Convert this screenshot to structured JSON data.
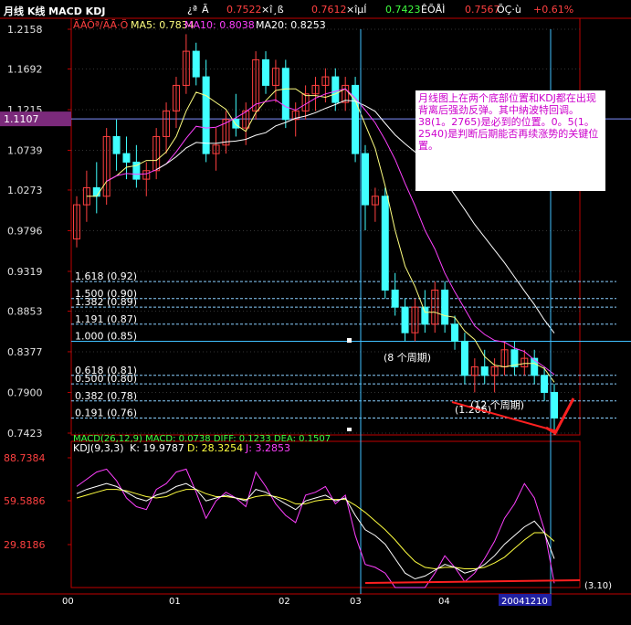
{
  "top_bar": {
    "title": "月线 K线 MACD KDJ",
    "fields": [
      {
        "label": "¿ª",
        "value": "Ã",
        "color": "#ffffff"
      },
      {
        "label": "",
        "value": "0.7522",
        "color": "#ff4040"
      },
      {
        "label": "×î¸ß",
        "value": "",
        "color": "#ffffff"
      },
      {
        "label": "",
        "value": "0.7612",
        "color": "#ff4040"
      },
      {
        "label": "×îµÍ",
        "value": "",
        "color": "#ffffff"
      },
      {
        "label": "",
        "value": "0.7423",
        "color": "#40ff40"
      },
      {
        "label": "ÊÕÅÌ",
        "value": "",
        "color": "#ffffff"
      },
      {
        "label": "",
        "value": "0.7567",
        "color": "#ff4040"
      },
      {
        "label": "ÕÇ·ù",
        "value": "",
        "color": "#ffffff"
      },
      {
        "label": "",
        "value": "+0.61%",
        "color": "#ff4040"
      }
    ]
  },
  "ma_legend": {
    "prefix": "ÃÀÔª/ÃÃ·Ö",
    "ma5": "MA5: 0.7834",
    "ma10": "MA10: 0.8038",
    "ma20": "MA20: 0.8253"
  },
  "price_axis_labels": [
    "1.2158",
    "1.1692",
    "1.1215",
    "1.0739",
    "1.0273",
    "0.9796",
    "0.9319",
    "0.8853",
    "0.8377",
    "0.7900",
    "0.7423"
  ],
  "current_price_label": "1.1107",
  "fib_levels": [
    {
      "label": "1.618 (0.92)",
      "value": 0.92
    },
    {
      "label": "1.500 (0.90)",
      "value": 0.9
    },
    {
      "label": "1.382 (0.89)",
      "value": 0.89
    },
    {
      "label": "1.191 (0.87)",
      "value": 0.87
    },
    {
      "label": "1.000 (0.85)",
      "value": 0.85
    },
    {
      "label": "0.618 (0.81)",
      "value": 0.81
    },
    {
      "label": "0.500 (0.80)",
      "value": 0.8
    },
    {
      "label": "0.382 (0.78)",
      "value": 0.78
    },
    {
      "label": "0.191 (0.76)",
      "value": 0.76
    }
  ],
  "annotations": {
    "box_text": "月线图上在两个底部位置和KDJ都在出现背离后强劲反弹。其中納波特回调。38(1。2765)是必到的位置。0。5(1。2540)是判断后期能否再续涨势的关键位置。",
    "cycle_label_1": "(8 个周期)",
    "cycle_label_2": "(12 个周期)",
    "cycle_label_3": "(1.206)"
  },
  "macd_line": "MACD(26,12,9)  MACD: 0.0738  DIFF: 0.1233  DEA: 0.1507",
  "kdj": {
    "legend_prefix": "KDJ(9,3,3)",
    "k_label": "K: 19.9787",
    "d_label": "D: 28.3254",
    "j_label": "J: 3.2853",
    "axis_labels": [
      "88.7384",
      "59.5886",
      "29.8186"
    ],
    "right_note": "(3.10)"
  },
  "x_axis": {
    "labels": [
      "00",
      "01",
      "02",
      "03",
      "04"
    ],
    "date_box": "20041210"
  },
  "colors": {
    "up": "#ff4040",
    "down": "#40ffff",
    "ma5": "#ffff80",
    "ma10": "#ff40ff",
    "ma20": "#ffffff",
    "k": "#ffffff",
    "d": "#ffff40",
    "j": "#ff40ff"
  },
  "chart_data": {
    "type": "candlestick",
    "title": "月线 K线 MACD KDJ",
    "ylim": [
      0.7423,
      1.2158
    ],
    "ohlc": [
      [
        0.97,
        1.02,
        0.96,
        1.01
      ],
      [
        1.01,
        1.05,
        0.99,
        1.03
      ],
      [
        1.03,
        1.06,
        1.0,
        1.02
      ],
      [
        1.02,
        1.1,
        1.01,
        1.09
      ],
      [
        1.09,
        1.11,
        1.05,
        1.07
      ],
      [
        1.07,
        1.09,
        1.04,
        1.06
      ],
      [
        1.06,
        1.08,
        1.03,
        1.04
      ],
      [
        1.04,
        1.06,
        1.02,
        1.05
      ],
      [
        1.05,
        1.1,
        1.04,
        1.09
      ],
      [
        1.09,
        1.13,
        1.07,
        1.12
      ],
      [
        1.12,
        1.16,
        1.1,
        1.15
      ],
      [
        1.15,
        1.21,
        1.14,
        1.19
      ],
      [
        1.19,
        1.2,
        1.15,
        1.16
      ],
      [
        1.16,
        1.18,
        1.06,
        1.07
      ],
      [
        1.07,
        1.1,
        1.05,
        1.08
      ],
      [
        1.08,
        1.12,
        1.07,
        1.11
      ],
      [
        1.11,
        1.14,
        1.09,
        1.1
      ],
      [
        1.1,
        1.13,
        1.08,
        1.12
      ],
      [
        1.12,
        1.19,
        1.11,
        1.18
      ],
      [
        1.18,
        1.19,
        1.14,
        1.15
      ],
      [
        1.15,
        1.18,
        1.13,
        1.17
      ],
      [
        1.17,
        1.18,
        1.1,
        1.11
      ],
      [
        1.11,
        1.13,
        1.09,
        1.12
      ],
      [
        1.12,
        1.15,
        1.11,
        1.14
      ],
      [
        1.14,
        1.16,
        1.12,
        1.15
      ],
      [
        1.15,
        1.17,
        1.13,
        1.16
      ],
      [
        1.16,
        1.17,
        1.12,
        1.13
      ],
      [
        1.13,
        1.16,
        1.12,
        1.15
      ],
      [
        1.15,
        1.16,
        1.06,
        1.07
      ],
      [
        1.07,
        1.08,
        0.98,
        1.01
      ],
      [
        1.01,
        1.03,
        0.99,
        1.02
      ],
      [
        1.02,
        1.03,
        0.9,
        0.91
      ],
      [
        0.91,
        0.93,
        0.88,
        0.89
      ],
      [
        0.89,
        0.9,
        0.85,
        0.86
      ],
      [
        0.86,
        0.9,
        0.85,
        0.89
      ],
      [
        0.89,
        0.91,
        0.86,
        0.87
      ],
      [
        0.87,
        0.92,
        0.86,
        0.91
      ],
      [
        0.91,
        0.92,
        0.86,
        0.87
      ],
      [
        0.87,
        0.88,
        0.84,
        0.85
      ],
      [
        0.85,
        0.86,
        0.8,
        0.81
      ],
      [
        0.81,
        0.83,
        0.79,
        0.82
      ],
      [
        0.82,
        0.84,
        0.8,
        0.81
      ],
      [
        0.81,
        0.83,
        0.79,
        0.82
      ],
      [
        0.82,
        0.85,
        0.81,
        0.84
      ],
      [
        0.84,
        0.85,
        0.81,
        0.82
      ],
      [
        0.82,
        0.84,
        0.81,
        0.83
      ],
      [
        0.83,
        0.84,
        0.8,
        0.81
      ],
      [
        0.81,
        0.82,
        0.78,
        0.79
      ],
      [
        0.79,
        0.8,
        0.74,
        0.76
      ]
    ],
    "kdj_ylim": [
      0,
      100
    ],
    "kdj_k": [
      65,
      68,
      70,
      72,
      70,
      66,
      62,
      60,
      64,
      66,
      70,
      72,
      68,
      60,
      62,
      64,
      62,
      60,
      68,
      66,
      62,
      58,
      54,
      60,
      62,
      64,
      60,
      62,
      50,
      40,
      36,
      30,
      20,
      10,
      6,
      8,
      12,
      16,
      14,
      10,
      12,
      16,
      22,
      30,
      36,
      42,
      46,
      38,
      20
    ],
    "kdj_d": [
      62,
      64,
      66,
      68,
      68,
      67,
      65,
      63,
      62,
      63,
      66,
      68,
      68,
      65,
      63,
      63,
      62,
      61,
      63,
      64,
      63,
      61,
      58,
      58,
      60,
      61,
      61,
      61,
      57,
      52,
      46,
      40,
      33,
      25,
      18,
      14,
      13,
      14,
      14,
      13,
      13,
      14,
      17,
      21,
      27,
      33,
      38,
      38,
      32
    ],
    "kdj_j": [
      70,
      75,
      80,
      82,
      74,
      62,
      56,
      54,
      68,
      72,
      80,
      82,
      66,
      48,
      60,
      66,
      62,
      56,
      80,
      70,
      58,
      50,
      45,
      64,
      66,
      70,
      58,
      64,
      36,
      16,
      14,
      10,
      0,
      0,
      0,
      0,
      10,
      22,
      14,
      4,
      10,
      20,
      32,
      48,
      58,
      72,
      62,
      40,
      3
    ]
  }
}
